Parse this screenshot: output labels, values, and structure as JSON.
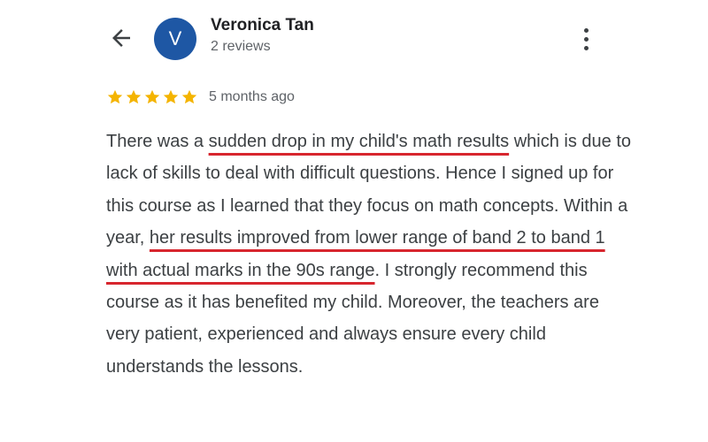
{
  "header": {
    "back_icon": "arrow-left-icon",
    "avatar_letter": "V",
    "avatar_color": "#1e57a4",
    "reviewer_name": "Veronica Tan",
    "review_count": "2 reviews",
    "more_icon": "more-vertical-icon"
  },
  "rating": {
    "stars": 5,
    "star_color": "#f4b400",
    "time_ago": "5 months ago"
  },
  "review": {
    "underline_color": "#d7262e",
    "segments": [
      {
        "text": "There was a ",
        "highlight": false
      },
      {
        "text": "sudden drop in my child's math results",
        "highlight": true
      },
      {
        "text": " which is due to lack of skills to deal with difficult questions. Hence I signed up for this course as I learned that they focus on math concepts. Within a year, ",
        "highlight": false
      },
      {
        "text": "her results improved from lower range of band 2 to band 1 with actual marks in the 90s range",
        "highlight": true
      },
      {
        "text": ". I strongly recommend this course as it has benefited my child. Moreover, the teachers are very patient, experienced and always ensure every child understands the lessons.",
        "highlight": false
      }
    ]
  }
}
